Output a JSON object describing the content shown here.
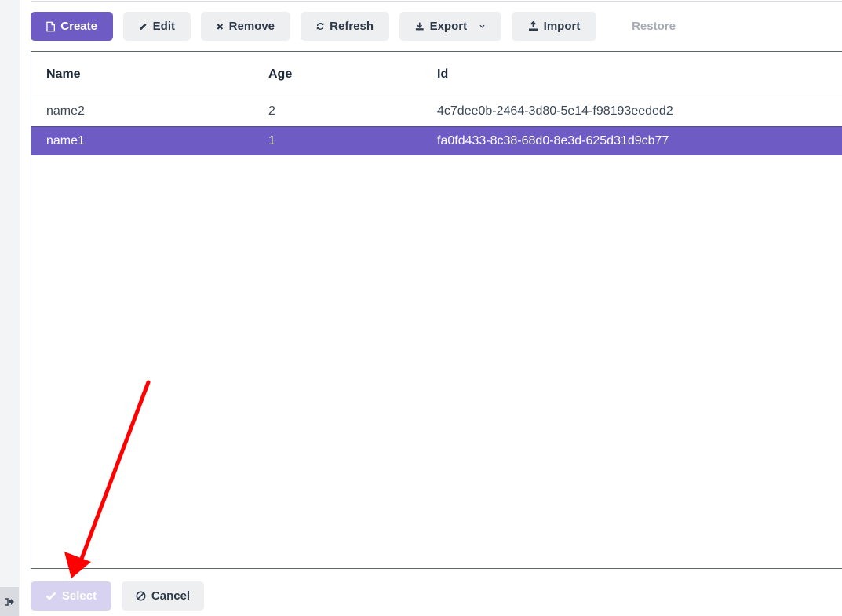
{
  "toolbar": {
    "create_label": "Create",
    "edit_label": "Edit",
    "remove_label": "Remove",
    "refresh_label": "Refresh",
    "export_label": "Export",
    "import_label": "Import",
    "restore_label": "Restore",
    "icons": {
      "create": "file-icon",
      "edit": "pencil-icon",
      "remove": "x-icon",
      "refresh": "refresh-icon",
      "export": "download-icon",
      "import": "upload-icon"
    }
  },
  "table": {
    "columns": [
      "Name",
      "Age",
      "Id"
    ],
    "rows": [
      {
        "name": "name2",
        "age": "2",
        "id": "4c7dee0b-2464-3d80-5e14-f98193eeded2",
        "selected": false
      },
      {
        "name": "name1",
        "age": "1",
        "id": "fa0fd433-8c38-68d0-8e3d-625d31d9cb77",
        "selected": true
      }
    ]
  },
  "footer": {
    "select_label": "Select",
    "cancel_label": "Cancel"
  },
  "colors": {
    "accent": "#6e5cc4",
    "annotation_arrow": "#ff0000"
  },
  "annotation": {
    "arrow_target": "select-button"
  }
}
